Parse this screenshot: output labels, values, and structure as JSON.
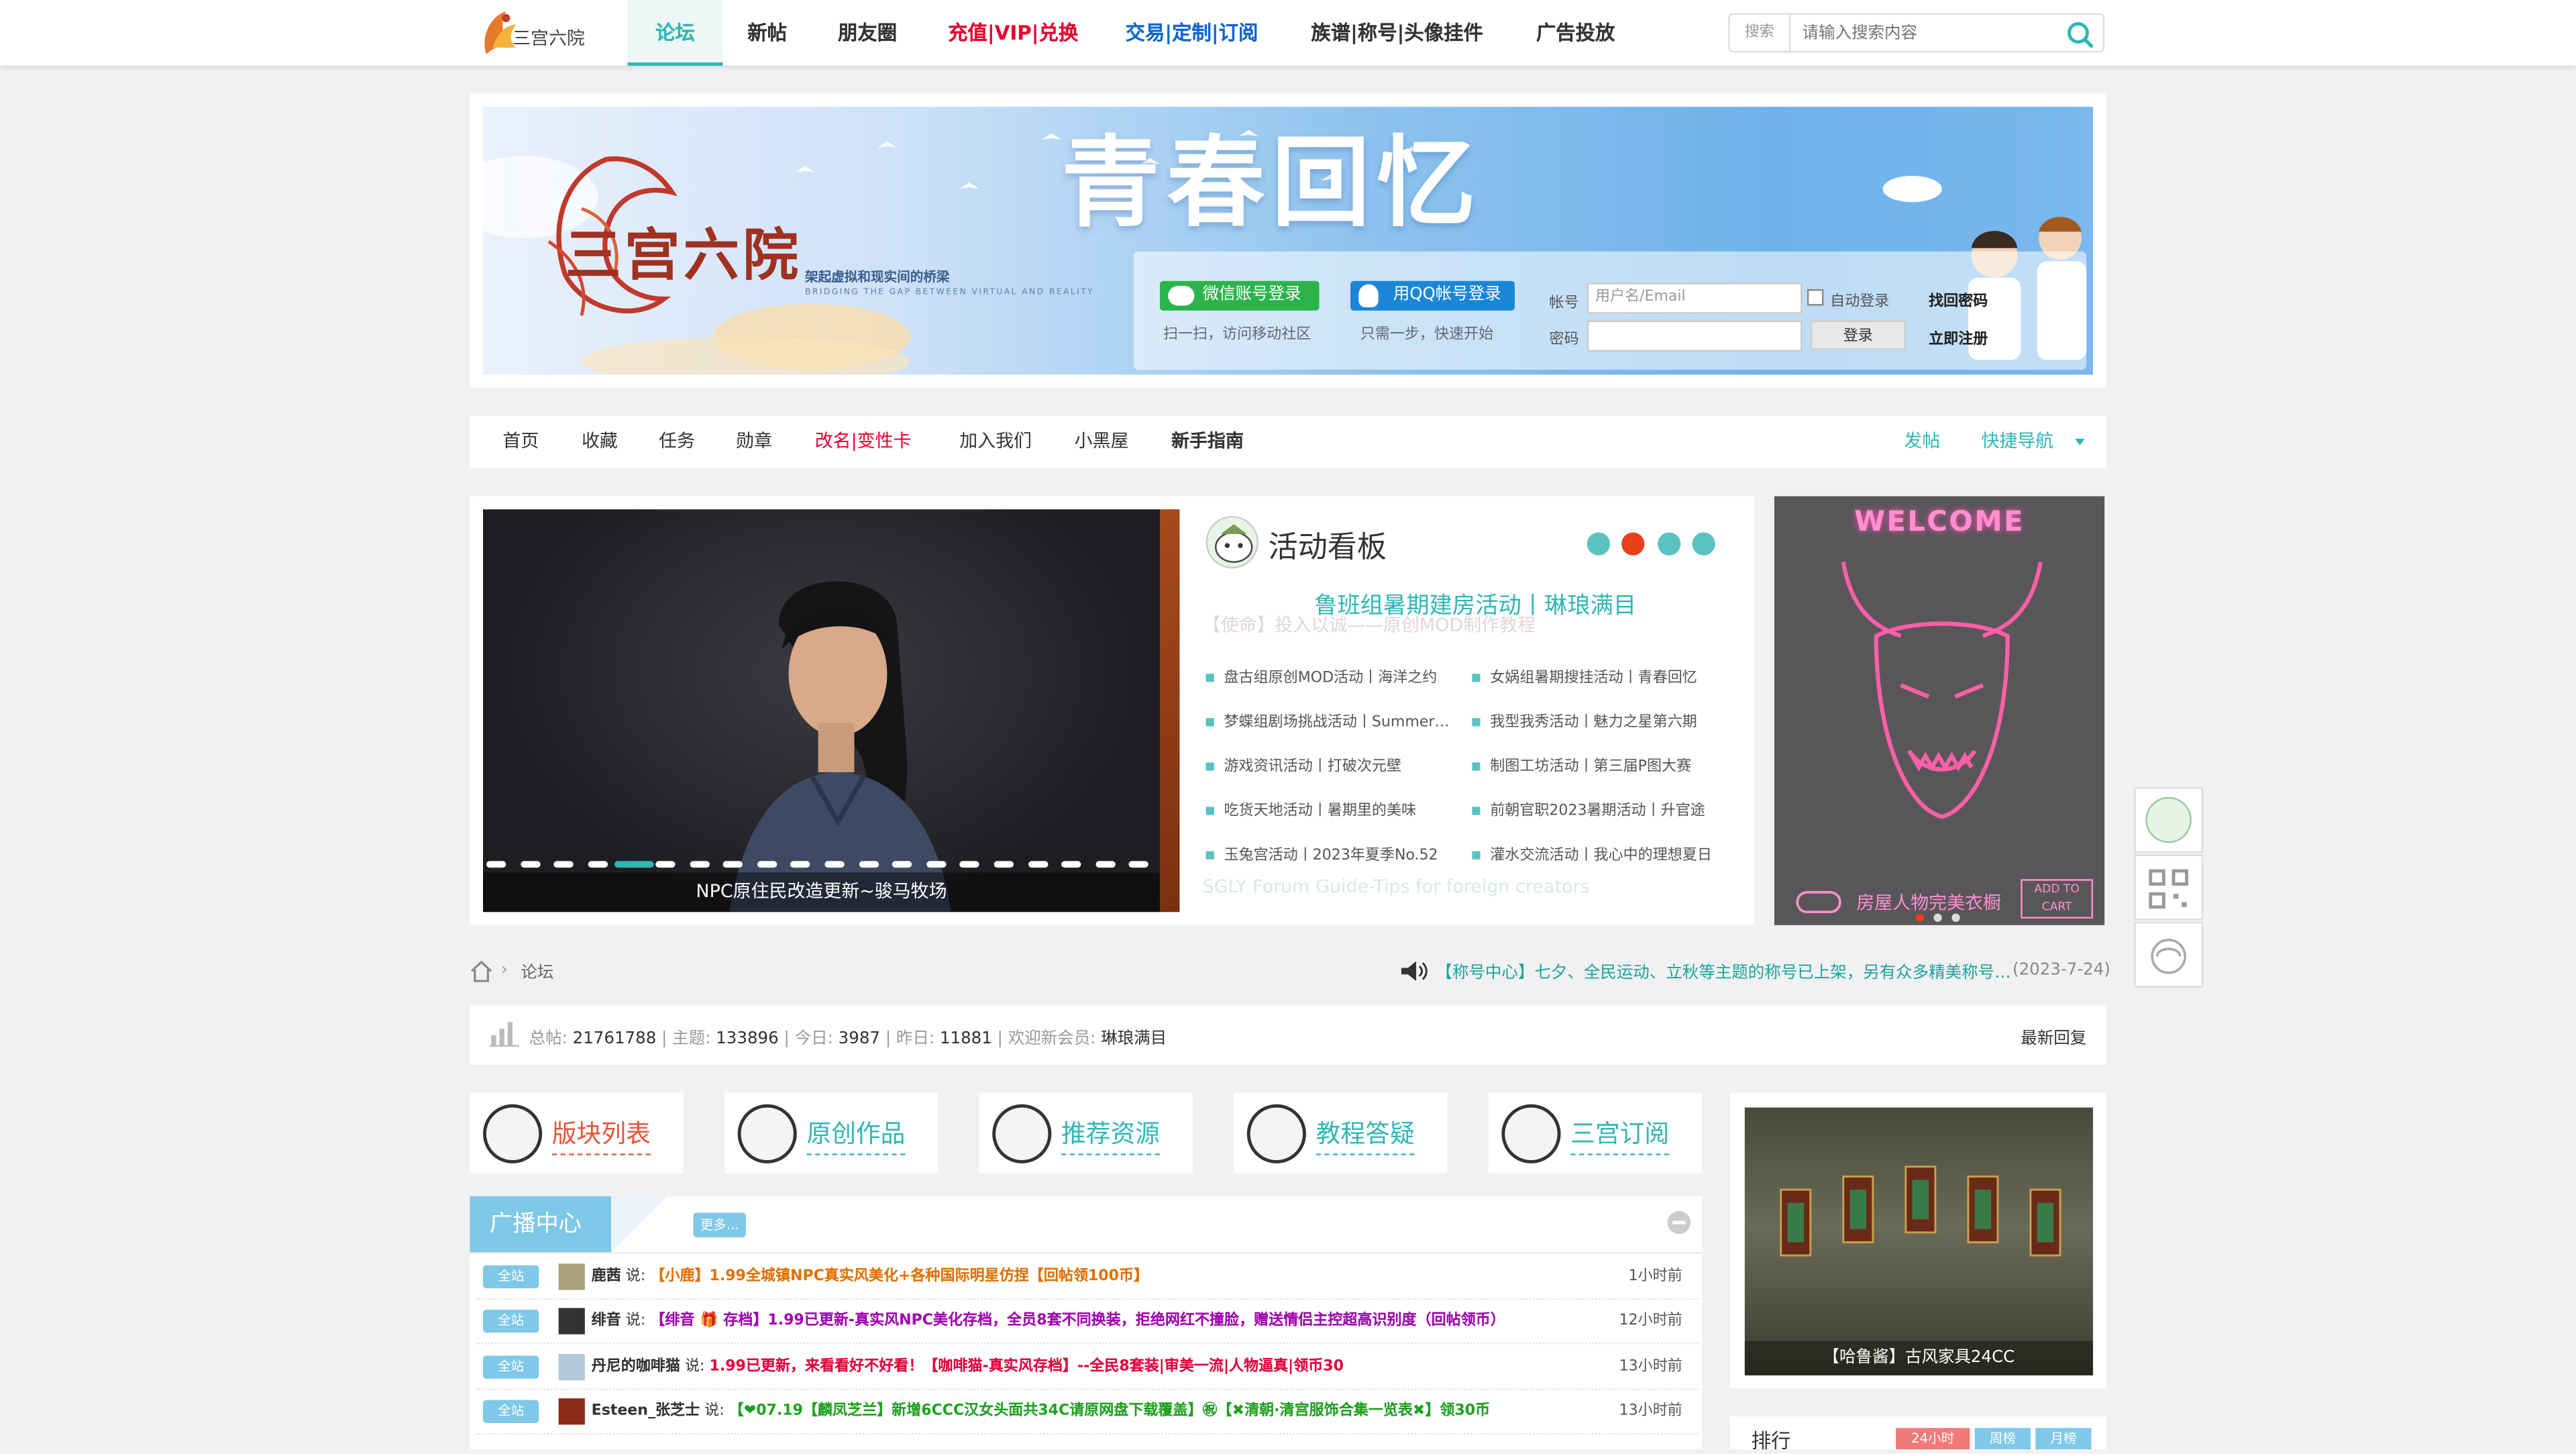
{
  "nav": {
    "logo_alt": "三宫六院",
    "items": [
      "论坛",
      "新帖",
      "朋友圈"
    ],
    "recharge": "充值|VIP|兑换",
    "trade": "交易|定制|订阅",
    "family": "族谱|称号|头像挂件",
    "ads": "广告投放",
    "search_label": "搜索",
    "search_placeholder": "请输入搜索内容"
  },
  "banner": {
    "title": "青春回忆",
    "site_name": "三宫六院",
    "slogan": "架起虚拟和现实间的桥梁",
    "slogan_en": "BRIDGING THE GAP BETWEEN VIRTUAL AND REALITY",
    "wechat_login": "微信账号登录",
    "qq_login": "用QQ帐号登录",
    "tip_wechat": "扫一扫，访问移动社区",
    "tip_qq": "只需一步，快速开始",
    "account_label": "帐号",
    "account_placeholder": "用户名/Email",
    "password_label": "密码",
    "auto_login": "自动登录",
    "find_password": "找回密码",
    "login_btn": "登录",
    "register": "立即注册"
  },
  "subnav": {
    "items": [
      "首页",
      "收藏",
      "任务",
      "勋章"
    ],
    "rename": "改名|变性卡",
    "join": "加入我们",
    "blackroom": "小黑屋",
    "guide": "新手指南",
    "post": "发帖",
    "quicknav": "快捷导航"
  },
  "slider": {
    "caption": "NPC原住民改造更新~骏马牧场",
    "dots": 20,
    "active_dot": 4
  },
  "activity": {
    "title": "活动看板",
    "headline": "鲁班组暑期建房活动丨琳琅满目",
    "links": [
      "盘古组原创MOD活动丨海洋之约",
      "女娲组暑期搜挂活动丨青春回忆",
      "梦蝶组剧场挑战活动丨Summer…",
      "我型我秀活动丨魅力之星第六期",
      "游戏资讯活动丨打破次元壁",
      "制图工坊活动丨第三届P图大赛",
      "吃货天地活动丨暑期里的美味",
      "前朝官职2023暑期活动丨升官途",
      "玉兔宫活动丨2023年夏季No.52",
      "灌水交流活动丨我心中的理想夏日"
    ],
    "ghost_1": "【使命】投入以诚——原创MOD制作教程",
    "ghost_2": "SGLY Forum Guide-Tips for foreign creators"
  },
  "welcome": {
    "title": "WELCOME",
    "footer": "房屋人物完美衣橱",
    "cart": "ADD TO CART"
  },
  "breadcrumb": {
    "forum": "论坛"
  },
  "notice": {
    "text": "【称号中心】七夕、全民运动、立秋等主题的称号已上架，另有众多精美称号…",
    "date": "(2023-7-24)"
  },
  "stats": {
    "total_posts_label": "总帖:",
    "total_posts": "21761788",
    "topics_label": "主题:",
    "topics": "133896",
    "today_label": "今日:",
    "today": "3987",
    "yesterday_label": "昨日:",
    "yesterday": "11881",
    "welcome_label": "欢迎新会员:",
    "new_member": "琳琅满目",
    "latest_reply": "最新回复"
  },
  "tiles": [
    "版块列表",
    "原创作品",
    "推荐资源",
    "教程答疑",
    "三宫订阅"
  ],
  "broadcast": {
    "title": "广播中心",
    "more": "更多...",
    "rows": [
      {
        "badge": "全站",
        "user": "鹿茜",
        "say": "说:",
        "msg": "【小鹿】1.99全城镇NPC真实风美化+各种国际明星仿捏【回帖领100币】",
        "time": "1小时前",
        "color": "#e07000"
      },
      {
        "badge": "全站",
        "user": "绯音",
        "say": "说:",
        "msg": "【绯音 🎁 存档】1.99已更新-真实风NPC美化存档，全员8套不同换装，拒绝网红不撞脸，赠送情侣主控超高识别度（回帖领币）",
        "time": "12小时前",
        "color": "#a000b0"
      },
      {
        "badge": "全站",
        "user": "丹尼的咖啡猫",
        "say": "说:",
        "msg": "1.99已更新，来看看好不好看！【咖啡猫-真实风存档】--全民8套装|审美一流|人物逼真|领币30",
        "time": "13小时前",
        "color": "#e0003a"
      },
      {
        "badge": "全站",
        "user": "Esteen_张芝士",
        "say": "说:",
        "msg": "【❤07.19【麟凤芝兰】新增6CCC汉女头面共34C请原网盘下载覆盖】㊗【✖清朝·清宫服饰合集一览表✖】领30币",
        "time": "13小时前",
        "color": "#20a020"
      }
    ]
  },
  "right": {
    "caption": "【哈鲁酱】古风家具24CC",
    "rank_title": "排行",
    "rank_tabs": [
      "24小时",
      "周榜",
      "月榜"
    ]
  },
  "colors": {
    "accent": "#2fb6b6",
    "red": "#e6002d",
    "blue": "#1166cc",
    "broadcast_blue": "#7ec8e8"
  }
}
